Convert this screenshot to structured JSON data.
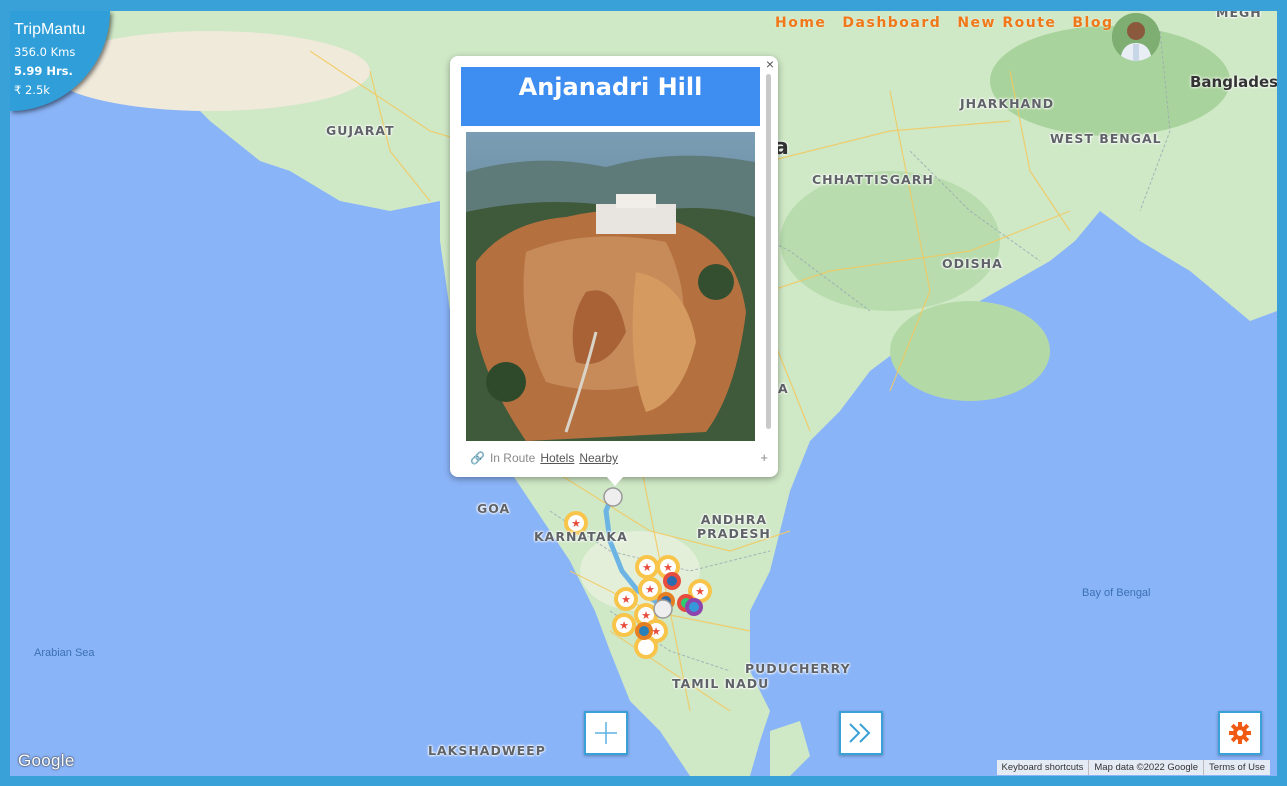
{
  "app": {
    "brand": "TripMantu"
  },
  "stats": {
    "distance": "356.0 Kms",
    "duration": "5.99 Hrs.",
    "cost": "₹ 2.5k"
  },
  "nav": {
    "items": [
      "Home",
      "Dashboard",
      "New Route",
      "Blog"
    ]
  },
  "user": {
    "avatar_icon": "user-avatar"
  },
  "popup": {
    "title": "Anjanadri Hill",
    "close_glyph": "×",
    "footer": {
      "status_icon": "route-link-icon",
      "status": "In Route",
      "hotels": "Hotels",
      "nearby": "Nearby",
      "expand_glyph": "+"
    }
  },
  "map": {
    "labels": {
      "gujarat": "GUJARAT",
      "jharkhand": "JHARKHAND",
      "west_bengal": "WEST BENGAL",
      "bangladesh": "Banglades",
      "meghalaya": "MEGH",
      "chhattisgarh": "CHHATTISGARH",
      "odisha": "ODISHA",
      "goa": "GOA",
      "karnataka": "KARNATAKA",
      "andhra": "ANDHRA\nPRADESH",
      "puducherry": "PUDUCHERRY",
      "tamil_nadu": "TAMIL NADU",
      "lakshadweep": "LAKSHADWEEP",
      "arabian_sea": "Arabian Sea",
      "bay_of_bengal": "Bay of Bengal",
      "india_frag": "a",
      "a_frag": "A"
    },
    "google": "Google",
    "attribution": [
      "Keyboard shortcuts",
      "Map data ©2022 Google",
      "Terms of Use"
    ]
  },
  "controls": {
    "add": "add-stop-button",
    "next": "next-button",
    "settings": "settings-button"
  },
  "colors": {
    "frame": "#3aa0d8",
    "nav": "#f07818",
    "popup_header": "#3e8df0",
    "sea": "#8ab4f8",
    "land": "#c4e6bf",
    "route": "#6cb4e4"
  }
}
